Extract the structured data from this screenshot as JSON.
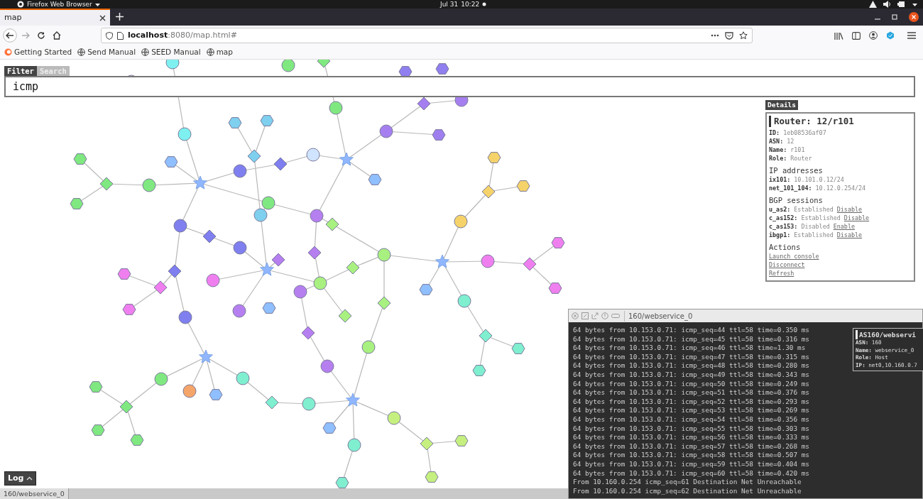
{
  "system_bar": {
    "app_menu": "Firefox Web Browser",
    "date": "Jul 31",
    "time": "10:22"
  },
  "browser": {
    "tabs": [
      {
        "label": "map",
        "selected": true
      }
    ],
    "url": {
      "host": "localhost",
      "rest": ":8080/map.html#"
    },
    "bookmarks": [
      {
        "label": "Getting Started",
        "kind": "firefox"
      },
      {
        "label": "Send Manual",
        "kind": "globe"
      },
      {
        "label": "SEED Manual",
        "kind": "globe"
      },
      {
        "label": "map",
        "kind": "globe"
      }
    ]
  },
  "filter": {
    "tabs": [
      {
        "label": "Filter",
        "selected": true
      },
      {
        "label": "Search",
        "selected": false
      }
    ],
    "value": "icmp"
  },
  "details": {
    "tab": "Details",
    "title": "Router: 12/r101",
    "sections": [
      {
        "rows": [
          {
            "text": "**ID:** 1eb08536af07"
          },
          {
            "text": "**ASN:** 12"
          },
          {
            "text": "**Name:** r101"
          },
          {
            "text": "**Role:** Router"
          }
        ]
      },
      {
        "heading": "IP addresses",
        "rows": [
          {
            "text": "**ix101:** 10.101.0.12/24"
          },
          {
            "text": "**net_101_104:** 10.12.0.254/24"
          }
        ]
      },
      {
        "heading": "BGP sessions",
        "rows": [
          {
            "text": "**u_as2:** Established",
            "action": "Disable"
          },
          {
            "text": "**c_as152:** Established",
            "action": "Disable"
          },
          {
            "text": "**c_as153:** Disabled",
            "action": "Enable"
          },
          {
            "text": "**ibgp1:** Established",
            "action": "Disable"
          }
        ]
      },
      {
        "heading": "Actions",
        "links": [
          "Launch console",
          "Disconnect",
          "Refresh"
        ]
      }
    ]
  },
  "log_button": {
    "label": "Log"
  },
  "console": {
    "title": "160/webservice_0",
    "lines": [
      "64 bytes from 10.153.0.71: icmp_seq=44 ttl=58 time=0.350 ms",
      "64 bytes from 10.153.0.71: icmp_seq=45 ttl=58 time=0.316 ms",
      "64 bytes from 10.153.0.71: icmp_seq=46 ttl=58 time=1.30 ms",
      "64 bytes from 10.153.0.71: icmp_seq=47 ttl=58 time=0.315 ms",
      "64 bytes from 10.153.0.71: icmp_seq=48 ttl=58 time=0.280 ms",
      "64 bytes from 10.153.0.71: icmp_seq=49 ttl=58 time=0.343 ms",
      "64 bytes from 10.153.0.71: icmp_seq=50 ttl=58 time=0.249 ms",
      "64 bytes from 10.153.0.71: icmp_seq=51 ttl=58 time=0.376 ms",
      "64 bytes from 10.153.0.71: icmp_seq=52 ttl=58 time=0.293 ms",
      "64 bytes from 10.153.0.71: icmp_seq=53 ttl=58 time=0.269 ms",
      "64 bytes from 10.153.0.71: icmp_seq=54 ttl=58 time=0.356 ms",
      "64 bytes from 10.153.0.71: icmp_seq=55 ttl=58 time=0.303 ms",
      "64 bytes from 10.153.0.71: icmp_seq=56 ttl=58 time=0.333 ms",
      "64 bytes from 10.153.0.71: icmp_seq=57 ttl=58 time=0.268 ms",
      "64 bytes from 10.153.0.71: icmp_seq=58 ttl=58 time=0.507 ms",
      "64 bytes from 10.153.0.71: icmp_seq=59 ttl=58 time=0.404 ms",
      "64 bytes from 10.153.0.71: icmp_seq=60 ttl=58 time=0.420 ms",
      "From 10.160.0.254 icmp_seq=61 Destination Net Unreachable",
      "From 10.160.0.254 icmp_seq=62 Destination Net Unreachable"
    ],
    "info": {
      "title": "AS160/webservi",
      "rows": [
        "**ASN:** 160",
        "**Name:** webservice_0",
        "**Role:** Host",
        "**IP:** net0,10.160.0.7"
      ]
    }
  },
  "bottom_tabs": [
    {
      "label": "160/webservice_0",
      "selected": true
    }
  ]
}
